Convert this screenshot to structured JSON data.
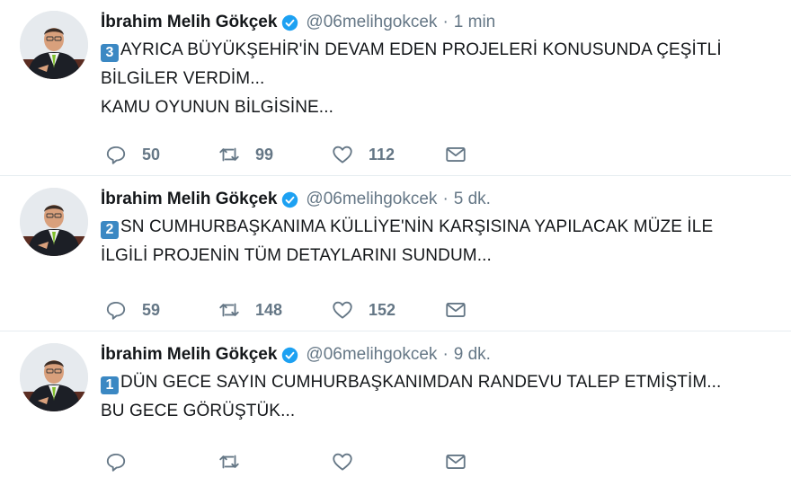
{
  "tweets": [
    {
      "name": "İbrahim Melih Gökçek",
      "handle": "@06melihgokcek",
      "separator": "·",
      "time": "1 min",
      "keycap": "3",
      "lines": [
        "AYRICA BÜYÜKŞEHİR'İN DEVAM EDEN PROJELERİ KONUSUNDA ÇEŞİTLİ",
        "BİLGİLER VERDİM...",
        "KAMU OYUNUN BİLGİSİNE..."
      ],
      "replies": "50",
      "retweets": "99",
      "likes": "112"
    },
    {
      "name": "İbrahim Melih Gökçek",
      "handle": "@06melihgokcek",
      "separator": "·",
      "time": "5 dk.",
      "keycap": "2",
      "lines": [
        "SN CUMHURBAŞKANIMA KÜLLİYE'NİN KARŞISINA YAPILACAK MÜZE İLE",
        "İLGİLİ PROJENİN TÜM DETAYLARINI SUNDUM..."
      ],
      "replies": "59",
      "retweets": "148",
      "likes": "152"
    },
    {
      "name": "İbrahim Melih Gökçek",
      "handle": "@06melihgokcek",
      "separator": "·",
      "time": "9 dk.",
      "keycap": "1",
      "lines": [
        "DÜN GECE SAYIN CUMHURBAŞKANIMDAN RANDEVU TALEP ETMİŞTİM...",
        "BU GECE GÖRÜŞTÜK..."
      ],
      "replies": "",
      "retweets": "",
      "likes": ""
    }
  ],
  "icons": {
    "reply": "reply-icon",
    "retweet": "retweet-icon",
    "like": "heart-icon",
    "dm": "mail-icon",
    "verified": "verified-badge-icon"
  },
  "colors": {
    "verified": "#1da1f2",
    "keycap": "#3b88c3",
    "muted": "#657786",
    "text": "#14171a",
    "divider": "#e6ecf0"
  }
}
